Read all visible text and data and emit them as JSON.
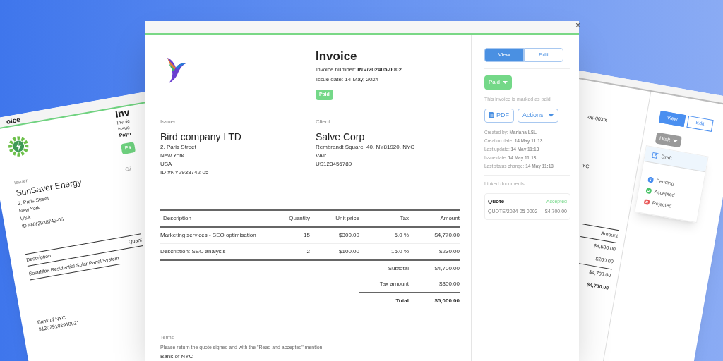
{
  "background_windows": {
    "left": {
      "title": "oice",
      "heading": "Inv",
      "meta": [
        "Invoic",
        "Issue",
        "Payn"
      ],
      "status_button": "Pa",
      "client_label": "Cli",
      "issuer_label": "Issuer",
      "issuer_name": "SunSaver Energy",
      "issuer_lines": [
        "2, Paris Street",
        "New York",
        "USA",
        "ID #NY2938742-05"
      ],
      "table": {
        "columns": [
          "Description",
          "Quant"
        ],
        "rows": [
          [
            "SolarMax Residential Solar Panel System"
          ]
        ]
      },
      "bank": [
        "Bank of NYC",
        "912029102910921"
      ]
    },
    "right": {
      "number": "-05-00XX",
      "client_fragment": "YC",
      "amount_header": "Amount",
      "amounts": [
        "$4,500.00",
        "$200.00",
        "$4,700.00",
        "$4,700.00"
      ],
      "tabs": [
        {
          "label": "View",
          "selected": true
        },
        {
          "label": "Edit",
          "selected": false
        }
      ],
      "status_button": "Draft",
      "menu": [
        {
          "label": "Draft",
          "kind": "edit",
          "selected": true
        },
        {
          "label": "Pending",
          "kind": "info",
          "selected": false,
          "color": "#4a8ff0"
        },
        {
          "label": "Accepted",
          "kind": "check",
          "selected": false,
          "color": "#4cc46a"
        },
        {
          "label": "Rejected",
          "kind": "cross",
          "selected": false,
          "color": "#e85454"
        }
      ]
    }
  },
  "window": {
    "close": "×"
  },
  "document": {
    "title": "Invoice",
    "invoice_number": "Invoice number: **INV/202405-0002**",
    "issue_date": "Issue date: 14 May, 2024",
    "status_badge": "Paid",
    "issuer": {
      "label": "Issuer",
      "name": "Bird company LTD",
      "lines": [
        "2, Paris Street",
        "New York",
        "USA",
        "ID #NY2938742-05"
      ]
    },
    "client": {
      "label": "Client",
      "name": "Salve Corp",
      "lines": [
        "Rembrandt Square, 40. NY81920. NYC",
        "VAT:",
        "US123456789"
      ]
    },
    "table": {
      "columns": [
        "Description",
        "Quantity",
        "Unit price",
        "Tax",
        "Amount"
      ],
      "rows": [
        [
          "Marketing services - SEO optimisation",
          "15",
          "$300.00",
          "6.0 %",
          "$4,770.00"
        ],
        [
          "Description: SEO analysis",
          "2",
          "$100.00",
          "15.0 %",
          "$230.00"
        ]
      ]
    },
    "totals": [
      {
        "label": "Subtotal",
        "value": "$4,700.00",
        "kind": "plain"
      },
      {
        "label": "Tax amount",
        "value": "$300.00",
        "kind": "plain"
      },
      {
        "label": "Total",
        "value": "$5,000.00",
        "kind": "grand"
      }
    ],
    "terms_label": "Terms",
    "terms": "Please return the quote signed and with the \"Read and accepted\" mention",
    "bank": "Bank of NYC"
  },
  "sidebar": {
    "tabs": [
      {
        "label": "View",
        "selected": true
      },
      {
        "label": "Edit",
        "selected": false
      }
    ],
    "status_button": "Paid",
    "status_note": "This invoice is marked as paid",
    "buttons": [
      {
        "label": "PDF",
        "kind": "pdf"
      },
      {
        "label": "Actions",
        "kind": "menu"
      }
    ],
    "meta": [
      "Created by: **Mariana LSL**",
      "Creation date: **14 May 11:13**",
      "Last update: **14 May 11:13**",
      "Issue date: **14 May 11:13**",
      "Last status change: **14 May 11:13**"
    ],
    "linked_label": "Linked documents",
    "linked": [
      {
        "type": "Quote",
        "status": "Accepted",
        "number": "QUOTE/2024-05-0002",
        "amount": "$4,700.00"
      }
    ]
  }
}
